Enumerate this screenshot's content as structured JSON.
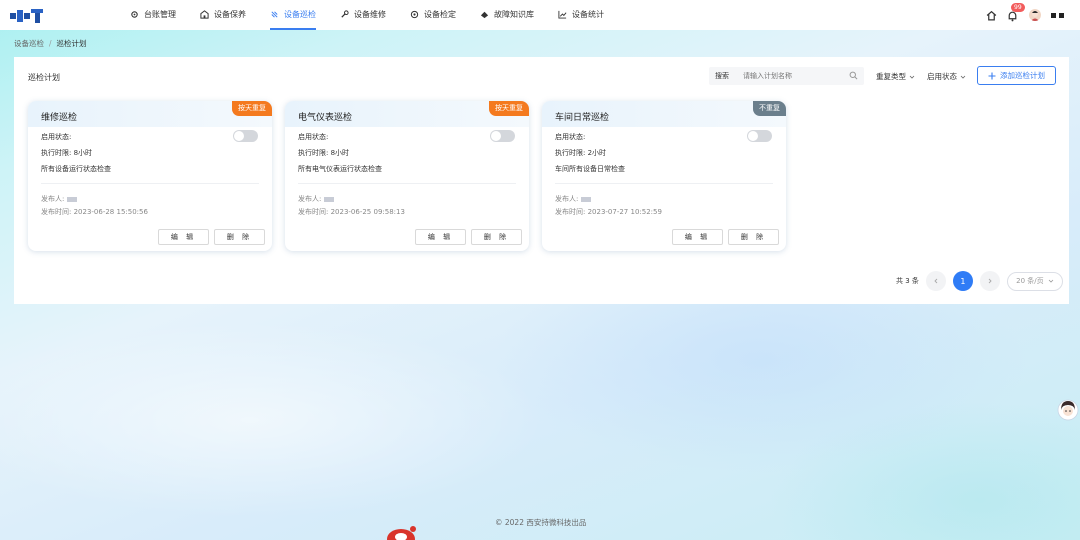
{
  "nav": {
    "items": [
      {
        "label": "台账管理",
        "icon": "gear-icon"
      },
      {
        "label": "设备保养",
        "icon": "building-icon"
      },
      {
        "label": "设备巡检",
        "icon": "patrol-icon"
      },
      {
        "label": "设备维修",
        "icon": "wrench-icon"
      },
      {
        "label": "设备检定",
        "icon": "target-icon"
      },
      {
        "label": "故障知识库",
        "icon": "knowledge-icon"
      },
      {
        "label": "设备统计",
        "icon": "chart-icon"
      }
    ],
    "active_index": 2,
    "notification_count": "99"
  },
  "breadcrumb": {
    "parent": "设备巡检",
    "separator": "/",
    "current": "巡检计划"
  },
  "panel": {
    "title": "巡检计划",
    "search_label": "搜索",
    "search_placeholder": "请输入计划名称",
    "filter_repeat_type": "重复类型",
    "filter_status": "启用状态",
    "add_button": "添加巡检计划"
  },
  "cards": [
    {
      "title": "维修巡检",
      "tag": "按天重复",
      "status_label": "启用状态:",
      "enabled": false,
      "time_limit": "执行时限: 8小时",
      "description": "所有设备运行状态检查",
      "publisher_label": "发布人:",
      "publish_time": "发布时间: 2023-06-28 15:50:56",
      "edit_label": "编 辑",
      "delete_label": "删 除"
    },
    {
      "title": "电气仪表巡检",
      "tag": "按天重复",
      "status_label": "启用状态:",
      "enabled": false,
      "time_limit": "执行时限: 8小时",
      "description": "所有电气仪表运行状态检查",
      "publisher_label": "发布人:",
      "publish_time": "发布时间: 2023-06-25 09:58:13",
      "edit_label": "编 辑",
      "delete_label": "删 除"
    },
    {
      "title": "车间日常巡检",
      "tag": "不重复",
      "status_label": "启用状态:",
      "enabled": false,
      "time_limit": "执行时限: 2小时",
      "description": "车间所有设备日常检查",
      "publisher_label": "发布人:",
      "publish_time": "发布时间: 2023-07-27 10:52:59",
      "edit_label": "编 辑",
      "delete_label": "删 除"
    }
  ],
  "pagination": {
    "total": "共 3 条",
    "current_page": "1",
    "page_size": "20 条/页"
  },
  "footer": "© 2022 西安持微科技出品",
  "colors": {
    "accent": "#3a7ef0",
    "tag_repeat": "#f47a1f",
    "tag_once": "#6b7f8c",
    "badge": "#f25c5c"
  }
}
